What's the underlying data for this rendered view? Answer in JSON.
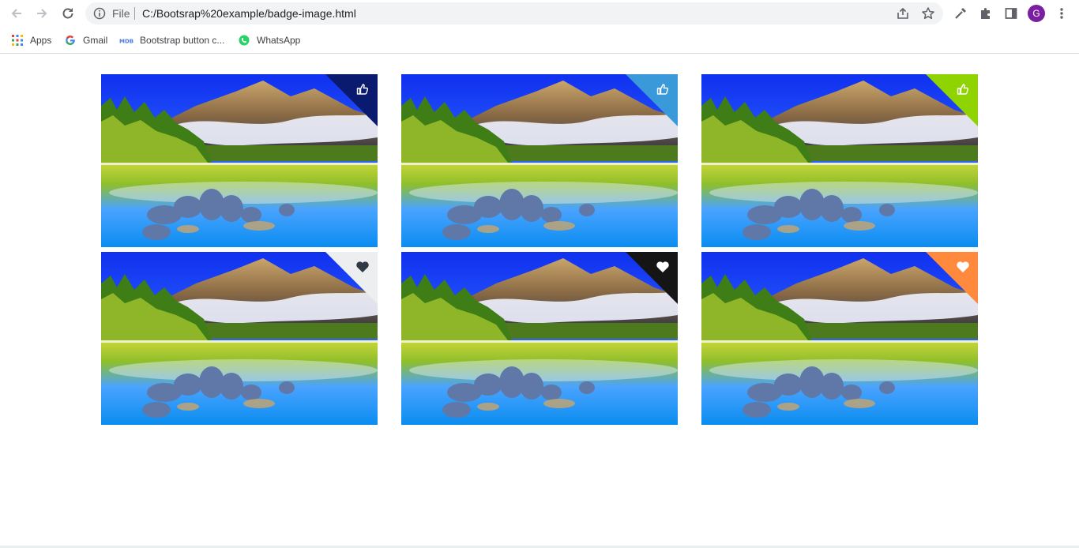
{
  "browser": {
    "omnibox": {
      "scheme_label": "File",
      "url": "C:/Bootsrap%20example/badge-image.html"
    },
    "profile_initial": "G",
    "bookmarks": [
      {
        "label": "Apps",
        "icon": "apps-grid-icon"
      },
      {
        "label": "Gmail",
        "icon": "google-icon"
      },
      {
        "label": "Bootstrap button c...",
        "icon": "mdb-icon"
      },
      {
        "label": "WhatsApp",
        "icon": "whatsapp-icon"
      }
    ]
  },
  "gallery": {
    "cards": [
      {
        "badge_icon": "thumbs-up-icon",
        "badge_color": "#0a1a6e",
        "icon_color": "#ffffff"
      },
      {
        "badge_icon": "thumbs-up-icon",
        "badge_color": "#3a9ad9",
        "icon_color": "#ffffff"
      },
      {
        "badge_icon": "thumbs-up-icon",
        "badge_color": "#8fd400",
        "icon_color": "#ffffff"
      },
      {
        "badge_icon": "heart-icon",
        "badge_color": "#eceeef",
        "icon_color": "#2f3a45"
      },
      {
        "badge_icon": "heart-icon",
        "badge_color": "#151515",
        "icon_color": "#ffffff"
      },
      {
        "badge_icon": "heart-icon",
        "badge_color": "#ff8a3d",
        "icon_color": "#ffffff"
      }
    ]
  }
}
